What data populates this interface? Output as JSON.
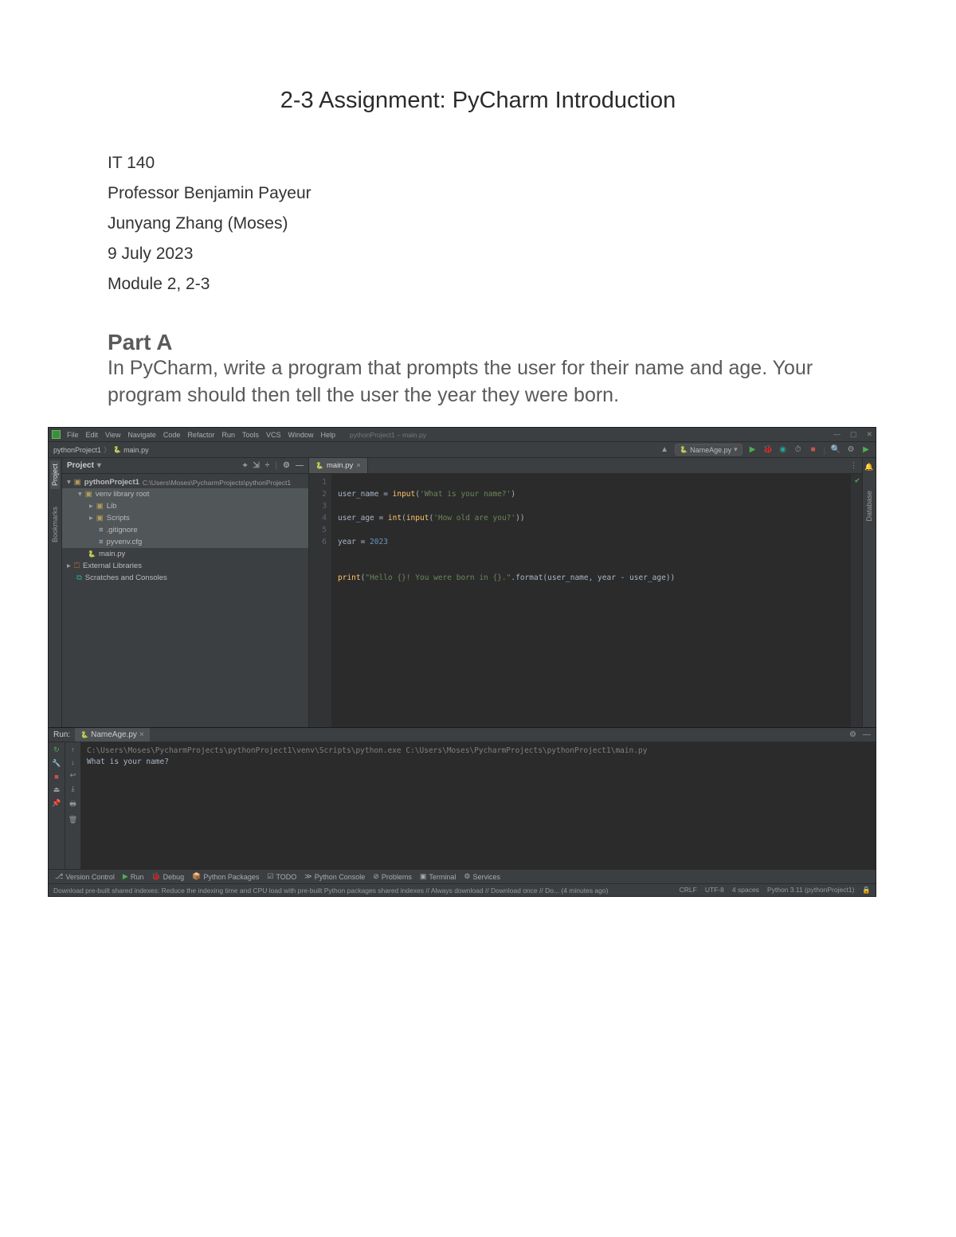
{
  "document": {
    "title": "2-3 Assignment: PyCharm Introduction",
    "header_lines": [
      "IT 140",
      "Professor Benjamin Payeur",
      "Junyang Zhang (Moses)",
      "9 July 2023",
      "Module 2, 2-3"
    ],
    "partA": {
      "heading": "Part A",
      "body": "In PyCharm, write a program that prompts the user for their name and age. Your program should then tell the user the year they were born."
    }
  },
  "ide": {
    "menu": [
      "File",
      "Edit",
      "View",
      "Navigate",
      "Code",
      "Refactor",
      "Run",
      "Tools",
      "VCS",
      "Window",
      "Help"
    ],
    "title_path": "pythonProject1 – main.py",
    "window_controls": [
      "—",
      "▢",
      "✕"
    ],
    "breadcrumb": {
      "project": "pythonProject1",
      "file": "main.py"
    },
    "toolbar_right": {
      "user_icon": "▲",
      "run_config_label": "NameAge.py",
      "icons": [
        "G",
        "⬣",
        "⟳",
        "⚙",
        "■"
      ],
      "search": "Q",
      "settings": "⚙"
    },
    "project_panel": {
      "title": "Project",
      "tree": {
        "root": {
          "name": "pythonProject1",
          "path": "C:\\Users\\Moses\\PycharmProjects\\pythonProject1"
        },
        "venv_label": "venv library root",
        "children": [
          "Lib",
          "Scripts",
          ".gitignore",
          "pyvenv.cfg"
        ],
        "main_file": "main.py",
        "external": "External Libraries",
        "scratches": "Scratches and Consoles"
      }
    },
    "editor": {
      "tab": "main.py",
      "lines": [
        "1",
        "2",
        "3",
        "4",
        "5",
        "6"
      ],
      "code": {
        "l1_a": "user_name = ",
        "l1_kw": "input",
        "l1_b": "(",
        "l1_s": "'What is your name?'",
        "l1_c": ")",
        "l2_a": "user_age = ",
        "l2_kw1": "int",
        "l2_b": "(",
        "l2_kw2": "input",
        "l2_c": "(",
        "l2_s": "'How old are you?'",
        "l2_d": "))",
        "l3_a": "year = ",
        "l3_n": "2023",
        "l4": "",
        "l5_kw": "print",
        "l5_a": "(",
        "l5_s": "\"Hello {}! You were born in {}.\"",
        "l5_b": ".format(user_name, year - user_age))",
        "l6": ""
      }
    },
    "run": {
      "label": "Run:",
      "tab": "NameAge.py",
      "cmd": "C:\\Users\\Moses\\PycharmProjects\\pythonProject1\\venv\\Scripts\\python.exe C:\\Users\\Moses\\PycharmProjects\\pythonProject1\\main.py",
      "out1": "What is your name?"
    },
    "bottom_tabs": [
      "Version Control",
      "Run",
      "Debug",
      "Python Packages",
      "TODO",
      "Python Console",
      "Problems",
      "Terminal",
      "Services"
    ],
    "status": {
      "msg": "Download pre-built shared indexes: Reduce the indexing time and CPU load with pre-built Python packages shared indexes // Always download // Download once // Do... (4 minutes ago)",
      "right": [
        "CRLF",
        "UTF-8",
        "4 spaces",
        "Python 3.11 (pythonProject1)"
      ]
    },
    "left_gutter": [
      "Project",
      "Bookmarks"
    ],
    "right_gutter": [
      "Notifications",
      "Database"
    ]
  }
}
